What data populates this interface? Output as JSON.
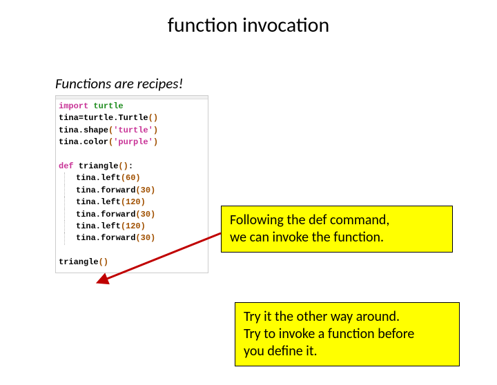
{
  "title": "function invocation",
  "subtitle": "Functions are recipes!",
  "code": {
    "l1_kw": "import",
    "l1_mod": "turtle",
    "l2a": "tina=turtle.Turtle",
    "l2b": "()",
    "l3a": "tina.shape",
    "l3b": "(",
    "l3c": "'turtle'",
    "l3d": ")",
    "l4a": "tina.color",
    "l4b": "(",
    "l4c": "'purple'",
    "l4d": ")",
    "l5a": "def",
    "l5b": " triangle",
    "l5c": "()",
    "l5d": ":",
    "l6a": "tina.left",
    "l6b": "(60)",
    "l7a": "tina.forward",
    "l7b": "(30)",
    "l8a": "tina.left",
    "l8b": "(120)",
    "l9a": "tina.forward",
    "l9b": "(30)",
    "l10a": "tina.left",
    "l10b": "(120)",
    "l11a": "tina.forward",
    "l11b": "(30)",
    "l12a": "triangle",
    "l12b": "()"
  },
  "callout1_line1": "Following the def command,",
  "callout1_line2": "we can invoke the function.",
  "callout2_line1": "Try it the other way around.",
  "callout2_line2": "Try to invoke a function before",
  "callout2_line3": "you define it."
}
